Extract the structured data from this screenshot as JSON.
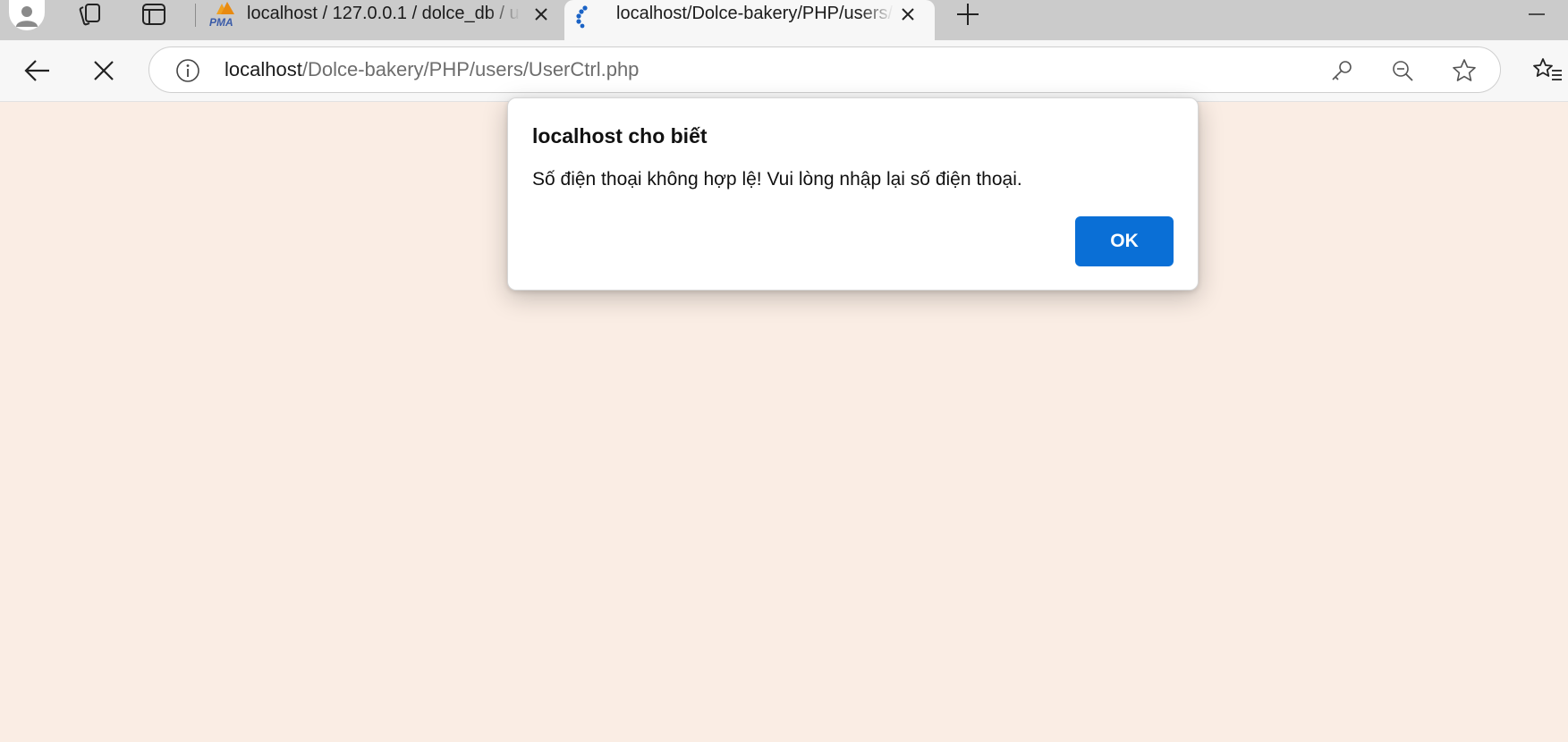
{
  "browser": {
    "tabs": [
      {
        "title": "localhost / 127.0.0.1 / dolce_db / u",
        "favicon": "phpmyadmin-icon",
        "favicon_text": "PMA",
        "active": false
      },
      {
        "title": "localhost/Dolce-bakery/PHP/users/UserCtrl.php",
        "favicon": "loading-spinner-icon",
        "active": true
      }
    ],
    "address": {
      "host": "localhost",
      "path": "/Dolce-bakery/PHP/users/UserCtrl.php"
    }
  },
  "dialog": {
    "title": "localhost cho biết",
    "message": "Số điện thoại không hợp lệ! Vui lòng nhập lại số điện thoại.",
    "ok_label": "OK"
  },
  "colors": {
    "page_background": "#faede4",
    "ok_button": "#0a6fd6",
    "tab_strip": "#cbcbcb",
    "toolbar": "#f7f7f7"
  }
}
